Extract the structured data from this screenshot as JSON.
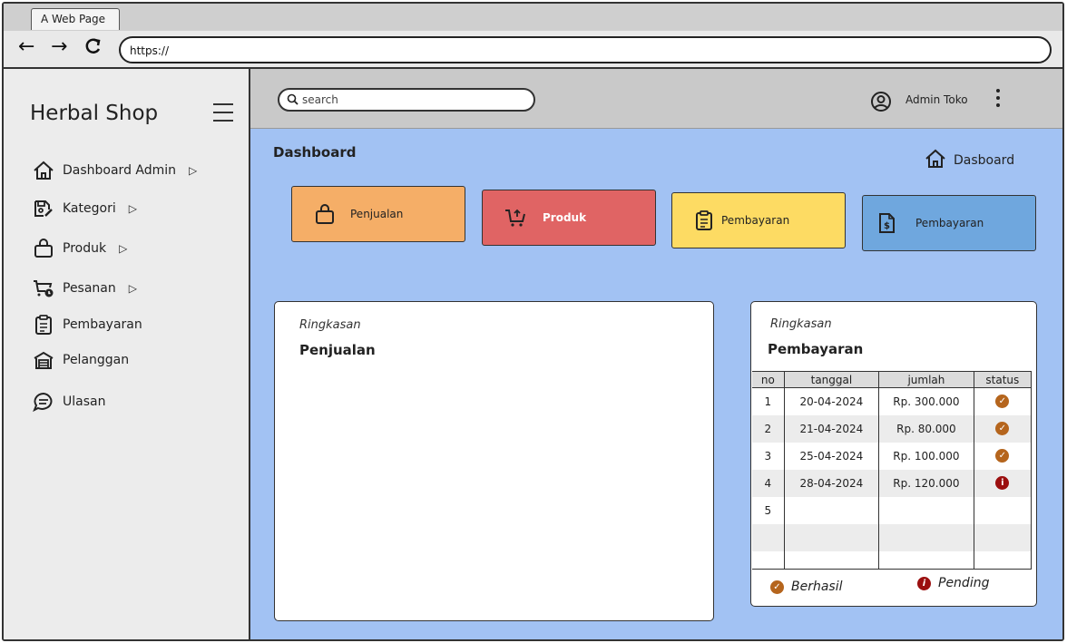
{
  "browser": {
    "tab_title": "A Web Page",
    "url": "https://"
  },
  "sidebar": {
    "brand": "Herbal Shop",
    "items": [
      {
        "label": "Dashboard Admin",
        "icon": "home-icon",
        "has_submenu": true
      },
      {
        "label": "Kategori",
        "icon": "save-edit-icon",
        "has_submenu": true
      },
      {
        "label": "Produk",
        "icon": "bag-icon",
        "has_submenu": true
      },
      {
        "label": "Pesanan",
        "icon": "cart-clock-icon",
        "has_submenu": true
      },
      {
        "label": "Pembayaran",
        "icon": "clipboard-icon",
        "has_submenu": false
      },
      {
        "label": "Pelanggan",
        "icon": "store-icon",
        "has_submenu": false
      },
      {
        "label": "Ulasan",
        "icon": "chat-icon",
        "has_submenu": false
      }
    ]
  },
  "topbar": {
    "search_placeholder": "search",
    "user_name": "Admin Toko"
  },
  "main": {
    "title": "Dashboard",
    "breadcrumb": "Dasboard",
    "cards": [
      {
        "label": "Penjualan",
        "color": "#f5ae67",
        "icon": "bag-icon"
      },
      {
        "label": "Produk",
        "color": "#e06464",
        "icon": "cart-icon"
      },
      {
        "label": "Pembayaran",
        "color": "#fddb63",
        "icon": "clipboard-icon"
      },
      {
        "label": "Pembayaran",
        "color": "#6fa7de",
        "icon": "invoice-icon"
      }
    ],
    "sales_panel": {
      "subtitle": "Ringkasan",
      "title": "Penjualan"
    },
    "payment_panel": {
      "subtitle": "Ringkasan",
      "title": "Pembayaran",
      "columns": [
        "no",
        "tanggal",
        "jumlah",
        "status"
      ],
      "rows": [
        {
          "no": "1",
          "tanggal": "20-04-2024",
          "jumlah": "Rp. 300.000",
          "status": "berhasil"
        },
        {
          "no": "2",
          "tanggal": "21-04-2024",
          "jumlah": "Rp. 80.000",
          "status": "berhasil"
        },
        {
          "no": "3",
          "tanggal": "25-04-2024",
          "jumlah": "Rp. 100.000",
          "status": "berhasil"
        },
        {
          "no": "4",
          "tanggal": "28-04-2024",
          "jumlah": "Rp. 120.000",
          "status": "pending"
        },
        {
          "no": "5",
          "tanggal": "",
          "jumlah": "",
          "status": ""
        }
      ],
      "legend_success": "Berhasil",
      "legend_pending": "Pending",
      "status_colors": {
        "berhasil": "#b5651d",
        "pending": "#9b0f0f"
      }
    }
  }
}
